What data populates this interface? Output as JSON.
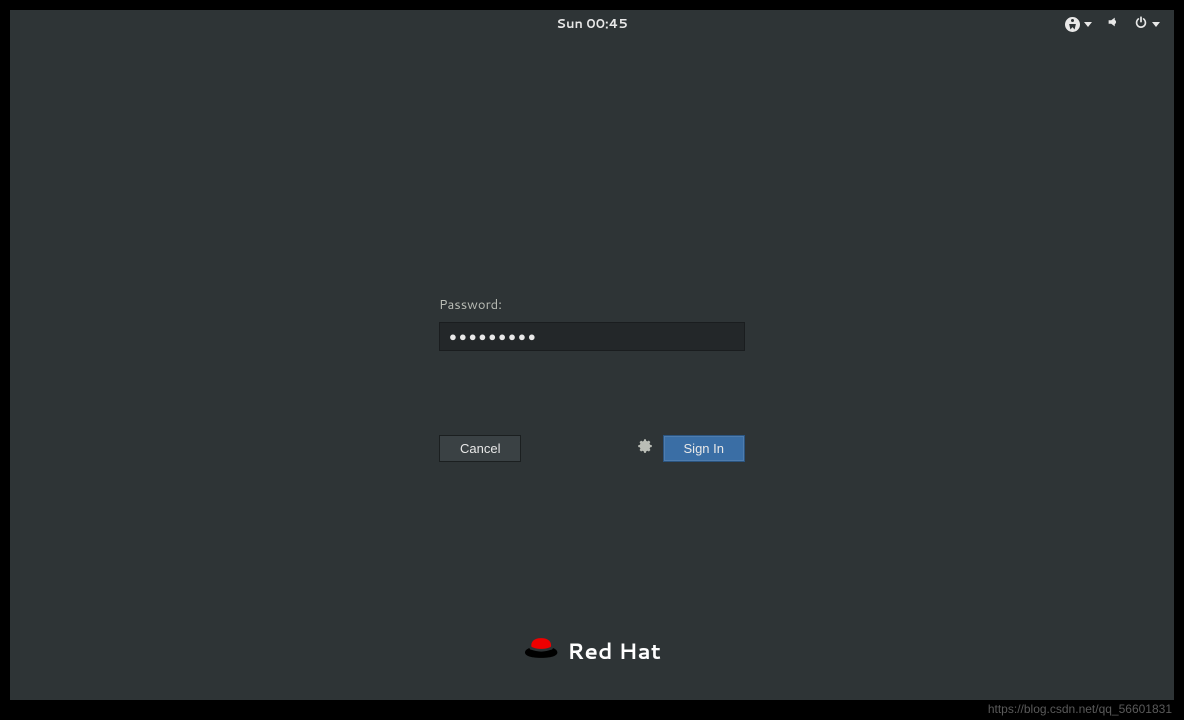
{
  "topbar": {
    "datetime": "Sun 00:45"
  },
  "login": {
    "password_label": "Password:",
    "password_value": "●●●●●●●●●",
    "cancel_label": "Cancel",
    "signin_label": "Sign In"
  },
  "brand": {
    "name": "Red Hat"
  },
  "watermark": "https://blog.csdn.net/qq_56601831"
}
